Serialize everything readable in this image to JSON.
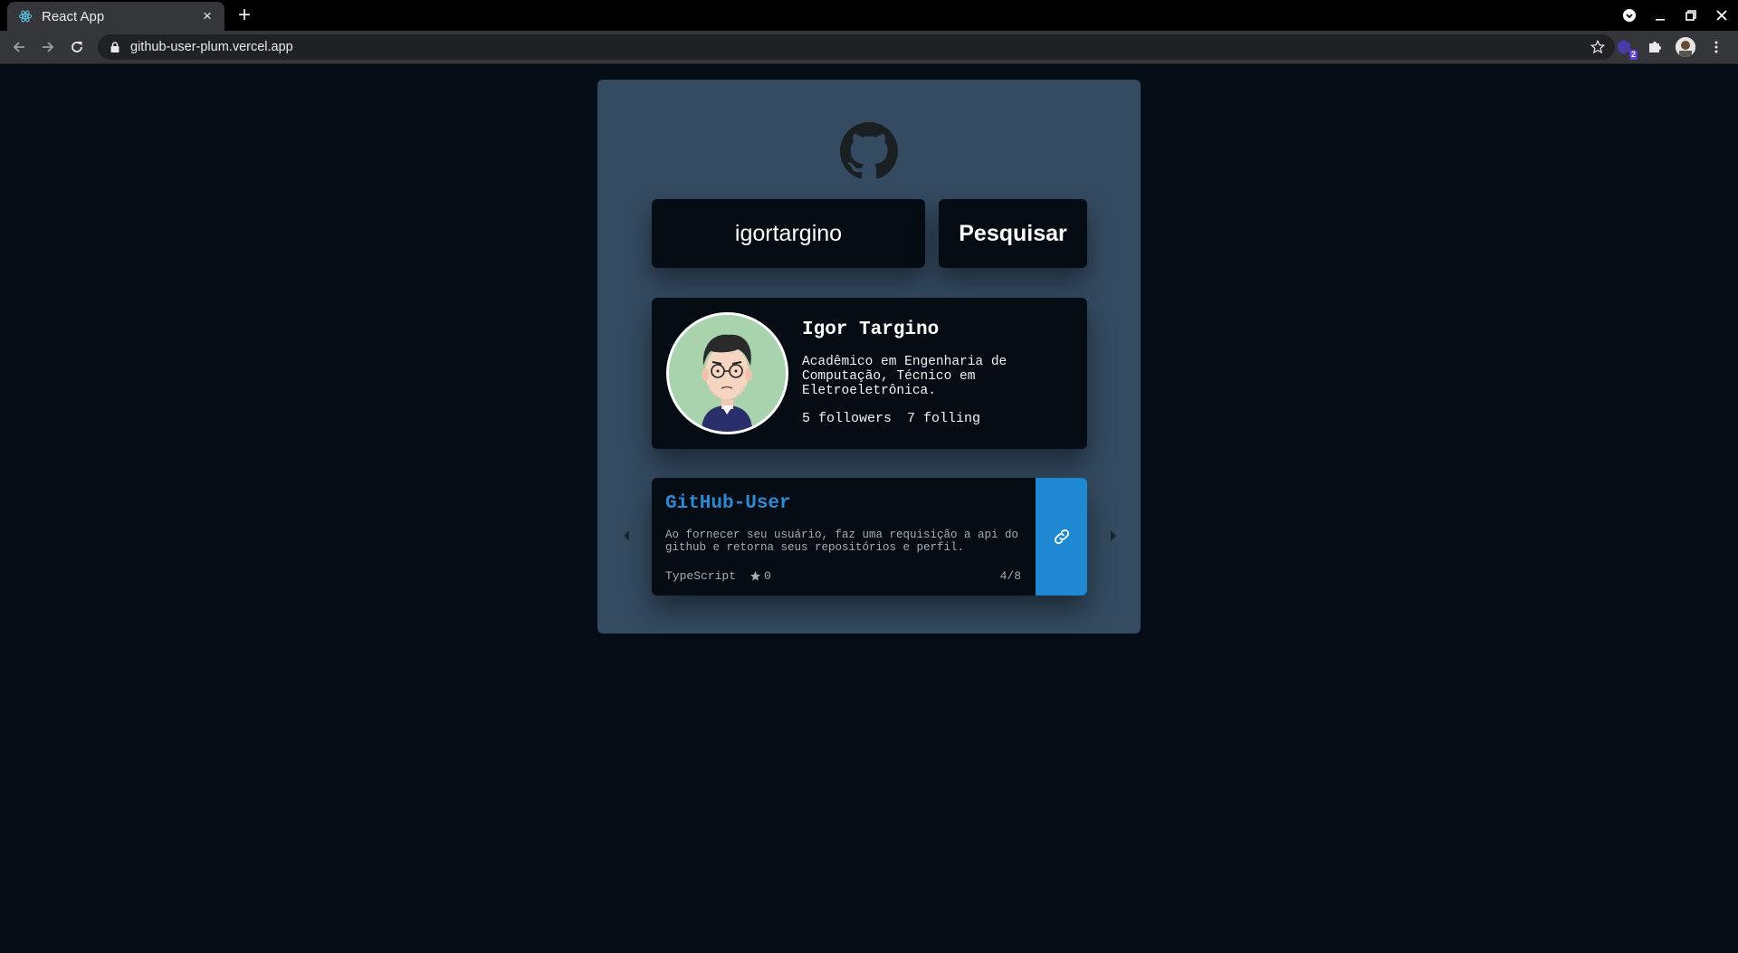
{
  "browser": {
    "tab_title": "React App",
    "tab_close": "×",
    "new_tab": "+",
    "url": "github-user-plum.vercel.app",
    "extension_badge": "2"
  },
  "search": {
    "value": "igortargino",
    "button_label": "Pesquisar"
  },
  "profile": {
    "name": "Igor Targino",
    "bio": "Acadêmico em Engenharia de Computação, Técnico em Eletroeletrônica.",
    "followers": "5 followers",
    "following": "7 folling"
  },
  "repo": {
    "name": "GitHub-User",
    "description": "Ao fornecer seu usuário, faz uma requisição a api do github e retorna seus repositórios e perfil.",
    "language": "TypeScript",
    "stars": "0",
    "page": "4/8"
  },
  "colors": {
    "page_bg": "#050e16",
    "card_bg": "#344b61",
    "panel_bg": "#050c14",
    "accent": "#1e88d2",
    "repo_title": "#2c8ad3"
  },
  "icons": [
    "react-favicon-icon",
    "github-logo-icon",
    "link-icon",
    "star-icon",
    "caret-left-icon",
    "caret-right-icon",
    "lock-icon",
    "bookmark-star-icon",
    "puzzle-icon",
    "back-icon",
    "forward-icon",
    "reload-icon"
  ]
}
